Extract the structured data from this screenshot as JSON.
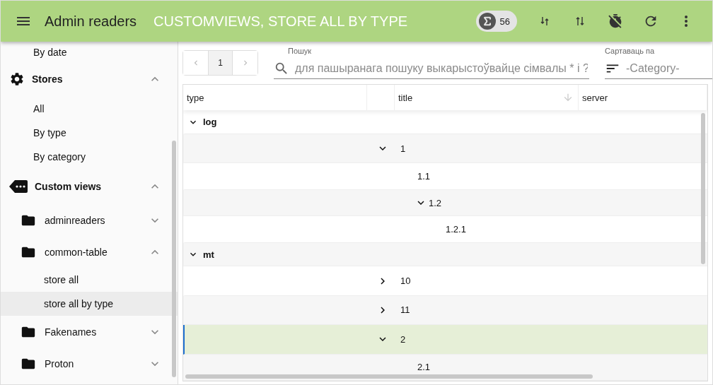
{
  "app_bar": {
    "title": "Admin readers",
    "subtitle": "CUSTOMVIEWS, STORE ALL BY TYPE",
    "count": "56"
  },
  "sidebar": {
    "items": [
      {
        "kind": "link",
        "label": "By date",
        "selected": false
      },
      {
        "kind": "section",
        "label": "Stores",
        "expanded": true,
        "children": [
          {
            "kind": "link",
            "label": "All",
            "selected": false
          },
          {
            "kind": "link",
            "label": "By type",
            "selected": false
          },
          {
            "kind": "link",
            "label": "By category",
            "selected": false
          }
        ]
      },
      {
        "kind": "section",
        "label": "Custom views",
        "expanded": true,
        "children": [
          {
            "kind": "folder",
            "label": "adminreaders",
            "expanded": false
          },
          {
            "kind": "folder",
            "label": "common-table",
            "expanded": true,
            "children": [
              {
                "kind": "link",
                "label": "store all",
                "selected": false
              },
              {
                "kind": "link",
                "label": "store all by type",
                "selected": true
              }
            ]
          },
          {
            "kind": "folder",
            "label": "Fakenames",
            "expanded": false
          },
          {
            "kind": "folder",
            "label": "Proton",
            "expanded": false
          }
        ]
      }
    ]
  },
  "pagination": {
    "page": "1"
  },
  "search": {
    "label": "Пошук",
    "placeholder": "для пашыранага пошуку выкарыстоўвайце сімвалы * і ?"
  },
  "sort": {
    "label": "Сартаваць па",
    "placeholder": "-Category-"
  },
  "table": {
    "columns": [
      {
        "label": "type",
        "sorted": false
      },
      {
        "label": "title",
        "sorted": true
      },
      {
        "label": "server",
        "sorted": false
      }
    ],
    "groups": [
      {
        "label": "log",
        "expanded": true,
        "selected": false,
        "rows": [
          {
            "title": "1",
            "expanded": true,
            "selected": false,
            "children": [
              {
                "title": "1.1",
                "selected": false
              },
              {
                "title": "1.2",
                "expanded": true,
                "selected": false,
                "children": [
                  {
                    "title": "1.2.1",
                    "selected": false
                  }
                ]
              }
            ]
          }
        ]
      },
      {
        "label": "mt",
        "expanded": true,
        "selected": false,
        "rows": [
          {
            "title": "10",
            "expanded": false,
            "selected": false
          },
          {
            "title": "11",
            "expanded": false,
            "selected": false
          },
          {
            "title": "2",
            "expanded": true,
            "selected": true,
            "children": [
              {
                "title": "2.1",
                "selected": false
              }
            ]
          }
        ]
      }
    ]
  }
}
